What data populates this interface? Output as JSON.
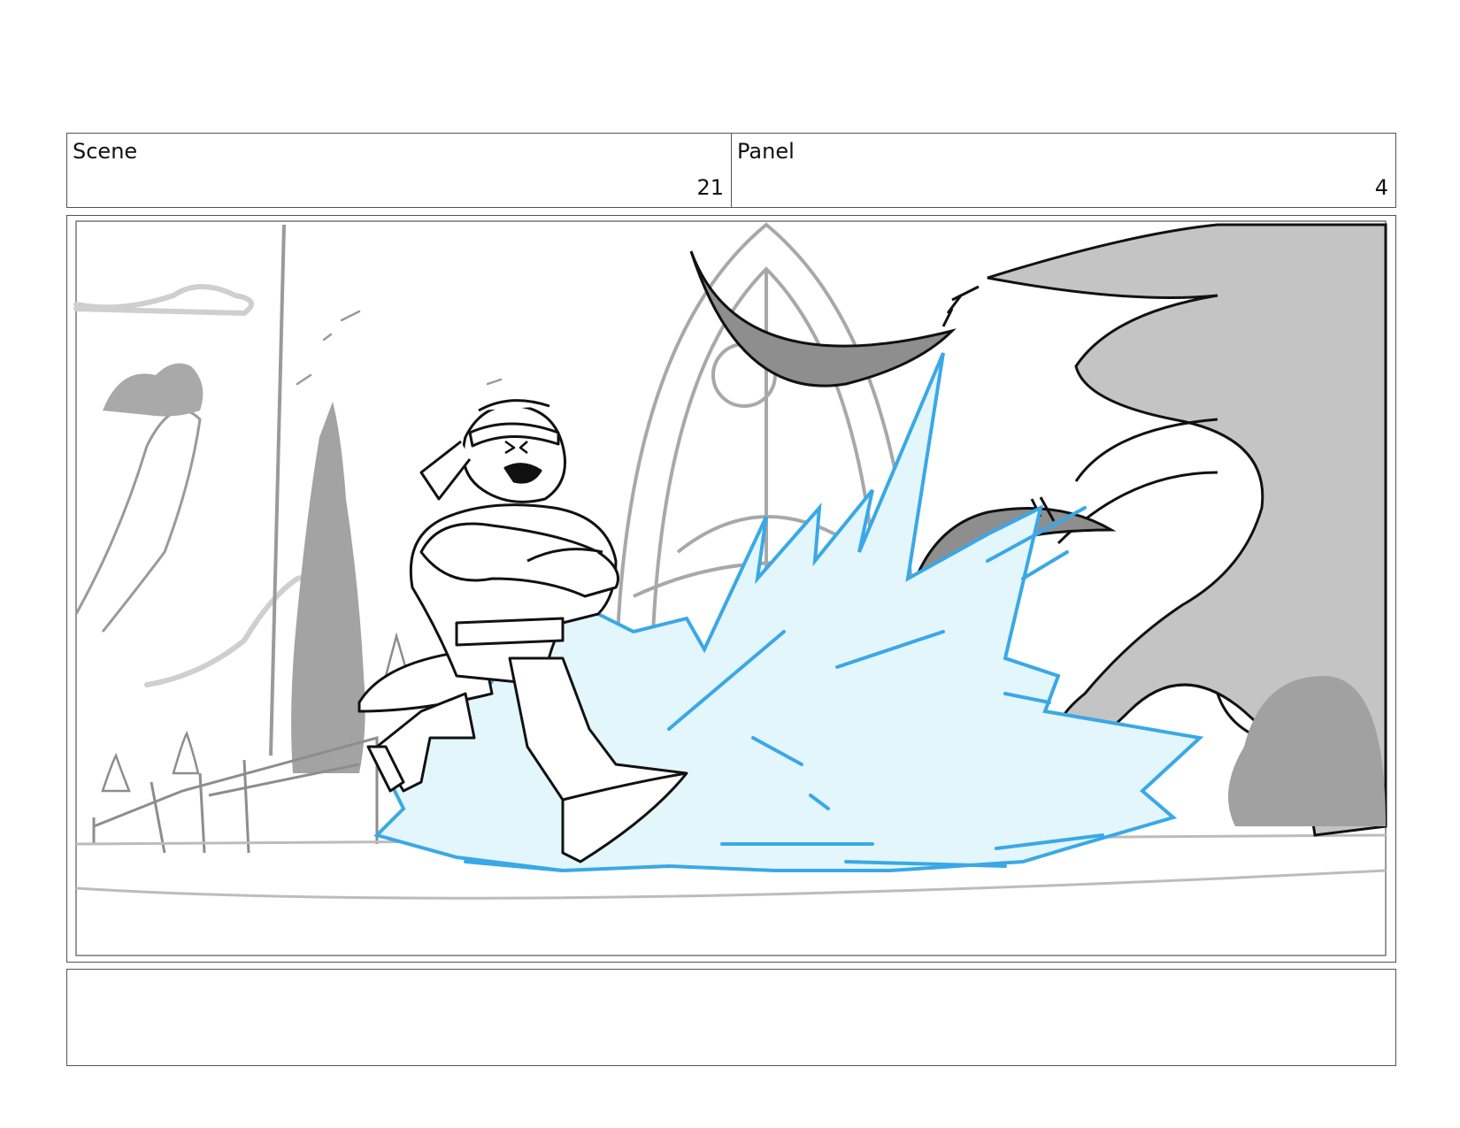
{
  "scene": {
    "label": "Scene",
    "value": "21"
  },
  "panel": {
    "label": "Panel",
    "value": "4"
  },
  "notes": {
    "text": ""
  },
  "artwork": {
    "subject": "storyboard sketch",
    "colors": {
      "line": "#111111",
      "background_line": "#9a9a9a",
      "gray_fill": "#bdbdbd",
      "energy_fill": "#e3f6fc",
      "energy_line": "#3aa8e6"
    }
  }
}
